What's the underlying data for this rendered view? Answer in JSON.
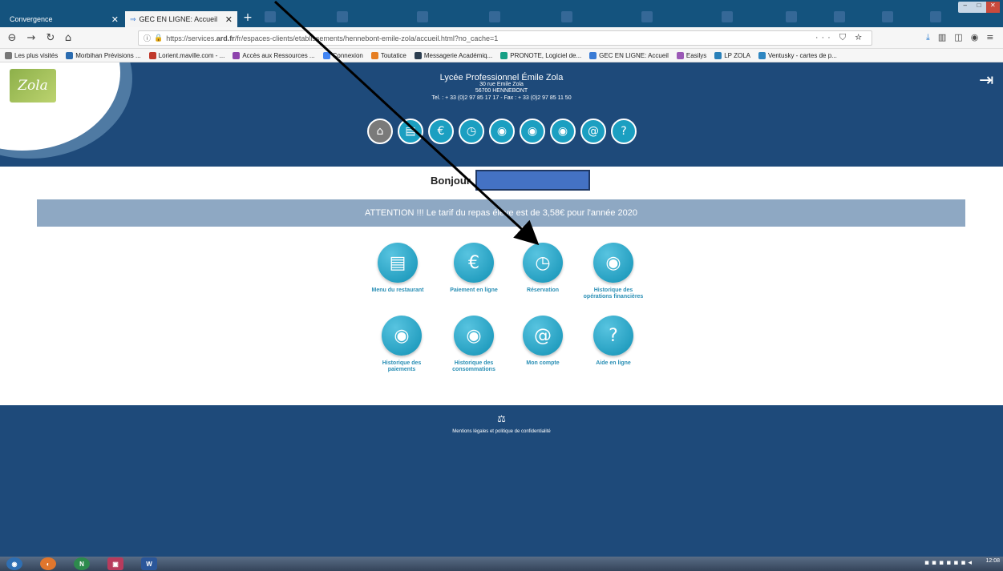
{
  "browser": {
    "tabs": [
      {
        "label": "Convergence",
        "active": false
      },
      {
        "label": "GEC EN LIGNE: Accueil",
        "active": true
      }
    ],
    "url_prefix": "https://services.",
    "url_host": "ard.fr",
    "url_rest": "/fr/espaces-clients/etablissements/hennebont-emile-zola/accueil.html?no_cache=1",
    "url_actions": "··· ⛉ ☆",
    "bookmarks": [
      {
        "label": "Les plus visités",
        "color": "#777777"
      },
      {
        "label": "Morbihan Prévisions ...",
        "color": "#2b6cb0"
      },
      {
        "label": "Lorient.maville.com - ...",
        "color": "#c0392b"
      },
      {
        "label": "Accès aux Ressources ...",
        "color": "#8e44ad"
      },
      {
        "label": "Connexion",
        "color": "#4285f4"
      },
      {
        "label": "Toutatice",
        "color": "#e67e22"
      },
      {
        "label": "Messagerie Académiq...",
        "color": "#2c3e50"
      },
      {
        "label": "PRONOTE, Logiciel de...",
        "color": "#16a085"
      },
      {
        "label": "GEC EN LIGNE: Accueil",
        "color": "#3a7bd5"
      },
      {
        "label": "Easilys",
        "color": "#9b59b6"
      },
      {
        "label": "LP ZOLA",
        "color": "#2980b9"
      },
      {
        "label": "Ventusky - cartes de p...",
        "color": "#2e86c1"
      }
    ]
  },
  "header": {
    "logo_text": "Zola",
    "school_name": "Lycée Professionnel Émile Zola",
    "address_line1": "30 rue Emile Zola",
    "address_line2": "56700 HENNEBONT",
    "contact_line": "Tel. : + 33 (0)2 97 85 17 17 - Fax : + 33 (0)2 97 85 11 50",
    "nav_icons": [
      {
        "name": "home-icon",
        "glyph": "⌂"
      },
      {
        "name": "menu-icon",
        "glyph": "▤"
      },
      {
        "name": "euro-icon",
        "glyph": "€"
      },
      {
        "name": "reservation-icon",
        "glyph": "◷"
      },
      {
        "name": "eye-icon",
        "glyph": "◉"
      },
      {
        "name": "eye-payments-icon",
        "glyph": "◉"
      },
      {
        "name": "eye-consumption-icon",
        "glyph": "◉"
      },
      {
        "name": "account-icon",
        "glyph": "@"
      },
      {
        "name": "help-icon",
        "glyph": "?"
      }
    ]
  },
  "greeting": "Bonjour",
  "banner": "ATTENTION !!! Le tarif du repas élève est de 3,58€ pour l'année 2020",
  "tiles": [
    {
      "name": "menu",
      "label": "Menu du restaurant",
      "glyph": "▤"
    },
    {
      "name": "payment",
      "label": "Paiement en ligne",
      "glyph": "€"
    },
    {
      "name": "reservation",
      "label": "Réservation",
      "glyph": "◷"
    },
    {
      "name": "financial-history",
      "label": "Historique des opérations financières",
      "glyph": "◉"
    },
    {
      "name": "payments-history",
      "label": "Historique des paiements",
      "glyph": "◉"
    },
    {
      "name": "consumption-history",
      "label": "Historique des consommations",
      "glyph": "◉"
    },
    {
      "name": "account",
      "label": "Mon compte",
      "glyph": "@"
    },
    {
      "name": "help",
      "label": "Aide en ligne",
      "glyph": "?"
    }
  ],
  "footer": {
    "icon": "⚖",
    "legal": "Mentions légales et politique de confidentialité"
  },
  "taskbar": {
    "clock_time": "12:08"
  }
}
